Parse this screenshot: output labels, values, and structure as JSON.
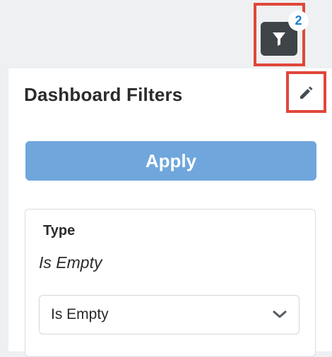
{
  "toolbar": {
    "filter_icon": "filter-icon",
    "active_filter_count": "2"
  },
  "panel": {
    "title": "Dashboard Filters",
    "edit_icon": "pencil-icon",
    "apply_label": "Apply"
  },
  "filters": [
    {
      "label": "Type",
      "summary": "Is Empty",
      "selected_option": "Is Empty"
    }
  ],
  "colors": {
    "highlight": "#e0473a",
    "apply_button": "#6fa6dc",
    "badge_text": "#1d7fd0",
    "filter_button": "#3f4448"
  }
}
